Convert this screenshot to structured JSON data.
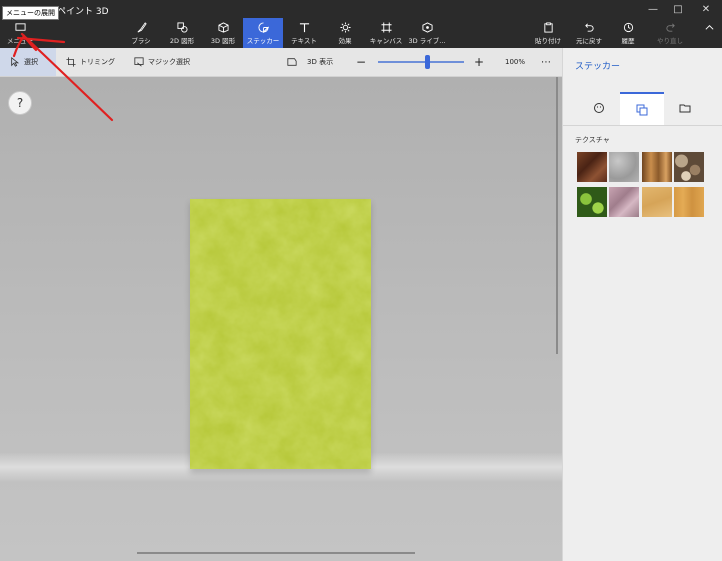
{
  "titlebar": {
    "app_title": "ペイント 3D",
    "tooltip": "メニューの展開"
  },
  "menu": {
    "label": "メニュー"
  },
  "toolbar": {
    "brush": "ブラシ",
    "shapes2d": "2D 図形",
    "shapes3d": "3D 図形",
    "stickers": "ステッカー",
    "text": "テキスト",
    "effects": "効果",
    "canvas": "キャンバス",
    "library3d": "3D ライブ...",
    "paste": "貼り付け",
    "undo": "元に戻す",
    "history": "履歴",
    "redo": "やり直し"
  },
  "toolstrip": {
    "select": "選択",
    "crop": "トリミング",
    "magic_select": "マジック選択",
    "view3d": "3D 表示",
    "zoom_value": "100%",
    "zoom_fraction": 0.57
  },
  "help": {
    "label": "?"
  },
  "panel": {
    "title": "ステッカー",
    "section_label": "テクスチャ",
    "tabs": [
      "sticker-icon",
      "texture-icon",
      "folder-icon"
    ]
  },
  "colors": {
    "accent": "#3b68d9",
    "annotation": "#e02020",
    "paper": "#b9c93a"
  }
}
